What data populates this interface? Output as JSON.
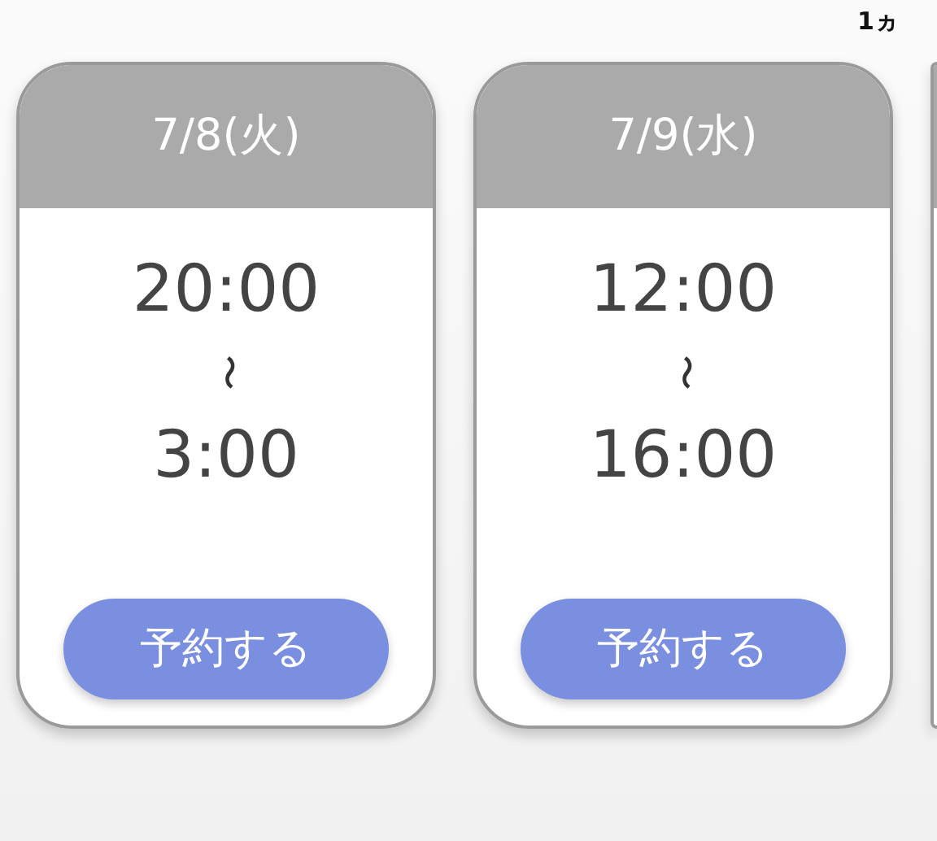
{
  "top_label": "1ヵ",
  "slots": [
    {
      "date": "7/8(火)",
      "start": "20:00",
      "separator": "〜",
      "end": "3:00",
      "button": "予約する"
    },
    {
      "date": "7/9(水)",
      "start": "12:00",
      "separator": "〜",
      "end": "16:00",
      "button": "予約する"
    }
  ]
}
